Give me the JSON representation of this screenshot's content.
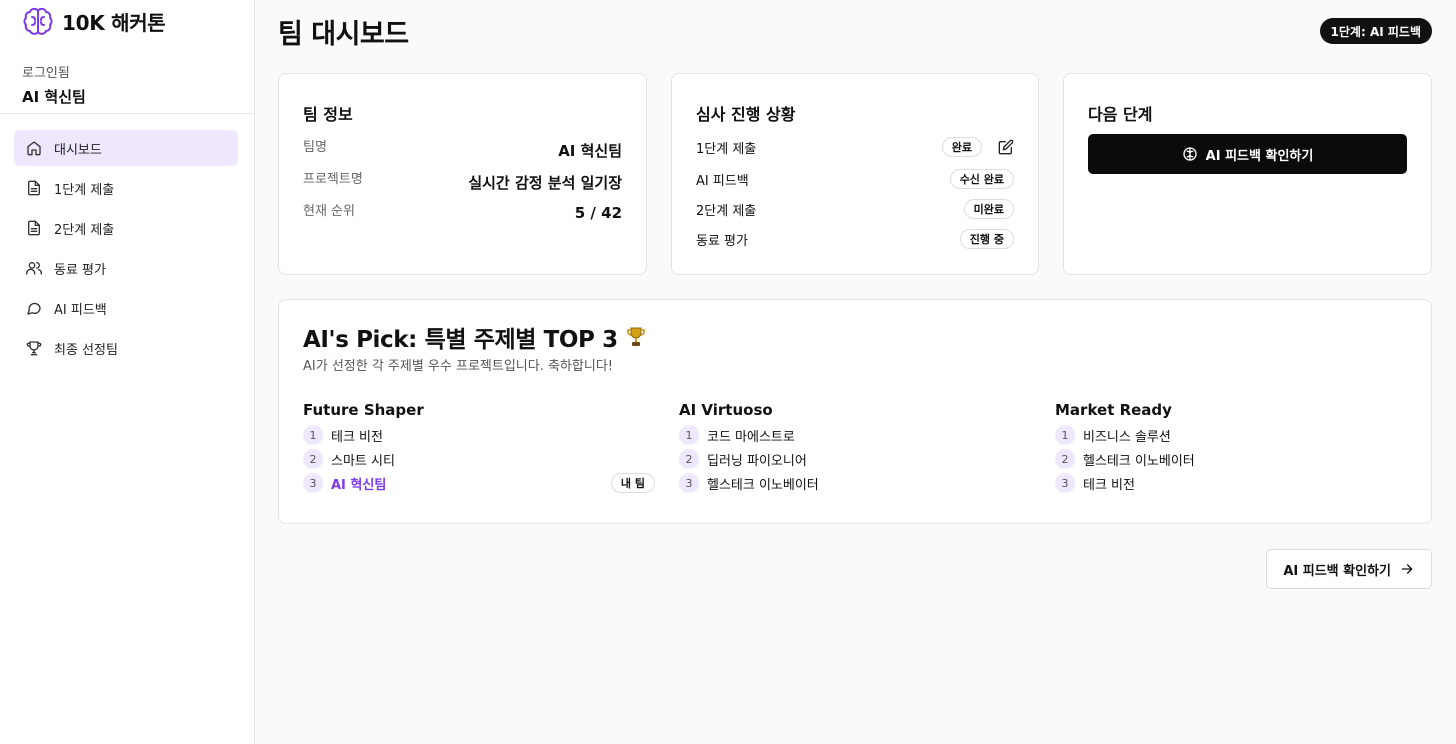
{
  "app": {
    "name": "10K 해커톤"
  },
  "login": {
    "label": "로그인됨",
    "team": "AI 혁신팀"
  },
  "sidebar": {
    "items": [
      {
        "label": "대시보드",
        "icon": "home-icon",
        "active": true
      },
      {
        "label": "1단계 제출",
        "icon": "document-icon"
      },
      {
        "label": "2단계 제출",
        "icon": "document-icon"
      },
      {
        "label": "동료 평가",
        "icon": "users-icon"
      },
      {
        "label": "AI 피드백",
        "icon": "message-icon"
      },
      {
        "label": "최종 선정팀",
        "icon": "trophy-icon"
      }
    ]
  },
  "header": {
    "title": "팀 대시보드",
    "stage_badge": "1단계: AI 피드백"
  },
  "team_info": {
    "title": "팀 정보",
    "rows": [
      {
        "key": "팀명",
        "value": "AI 혁신팀"
      },
      {
        "key": "프로젝트명",
        "value": "실시간 감정 분석 일기장"
      },
      {
        "key": "현재 순위",
        "value": "5 / 42"
      }
    ]
  },
  "review_status": {
    "title": "심사 진행 상황",
    "rows": [
      {
        "label": "1단계 제출",
        "status": "완료"
      },
      {
        "label": "AI 피드백",
        "status": "수신 완료"
      },
      {
        "label": "2단계 제출",
        "status": "미완료"
      },
      {
        "label": "동료 평가",
        "status": "진행 중"
      }
    ]
  },
  "next_step": {
    "title": "다음 단계",
    "button_label": "AI 피드백 확인하기"
  },
  "ai_pick": {
    "title": "AI's Pick: 특별 주제별 TOP 3",
    "subtitle": "AI가 선정한 각 주제별 우수 프로젝트입니다. 축하합니다!",
    "my_team_badge": "내 팀",
    "categories": [
      {
        "name": "Future Shaper",
        "teams": [
          {
            "rank": "1",
            "name": "테크 비전"
          },
          {
            "rank": "2",
            "name": "스마트 시티"
          },
          {
            "rank": "3",
            "name": "AI 혁신팀",
            "mine": true
          }
        ]
      },
      {
        "name": "AI Virtuoso",
        "teams": [
          {
            "rank": "1",
            "name": "코드 마에스트로"
          },
          {
            "rank": "2",
            "name": "딥러닝 파이오니어"
          },
          {
            "rank": "3",
            "name": "헬스테크 이노베이터"
          }
        ]
      },
      {
        "name": "Market Ready",
        "teams": [
          {
            "rank": "1",
            "name": "비즈니스 솔루션"
          },
          {
            "rank": "2",
            "name": "헬스테크 이노베이터"
          },
          {
            "rank": "3",
            "name": "테크 비전"
          }
        ]
      }
    ]
  },
  "footer": {
    "button_label": "AI 피드백 확인하기"
  },
  "colors": {
    "accent": "#7c3aed",
    "accent_bg": "#efe7fd",
    "primary": "#0b0b0b"
  }
}
